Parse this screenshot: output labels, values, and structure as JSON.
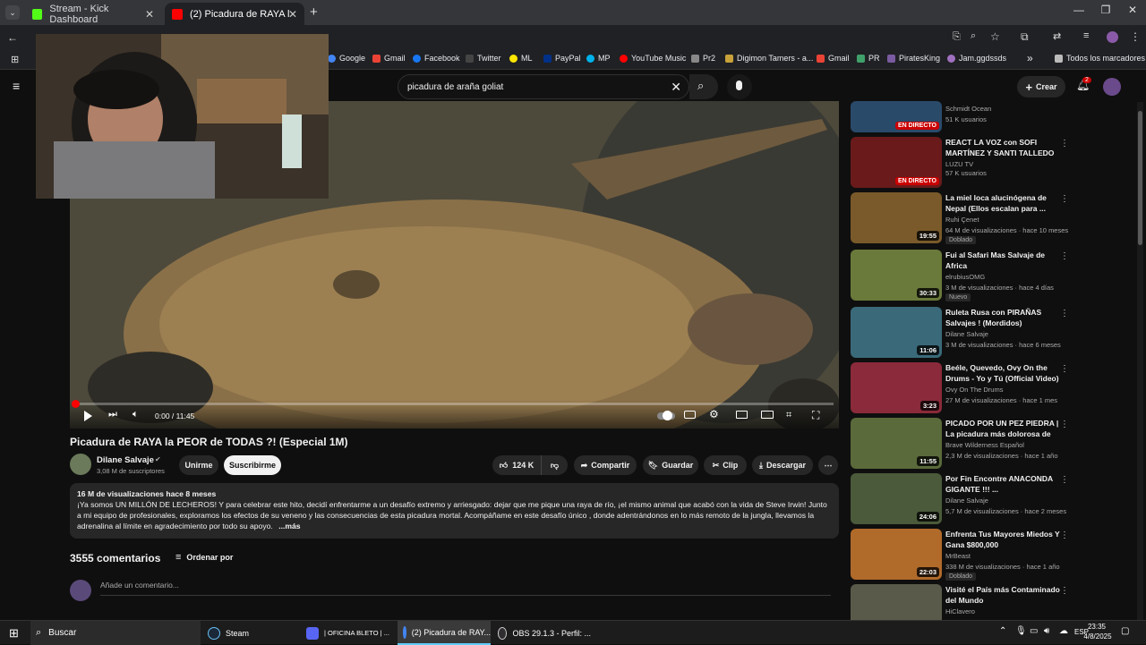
{
  "browser": {
    "tabs": [
      {
        "title": "Stream - Kick Dashboard",
        "color": "#53fc18"
      },
      {
        "title": "(2) Picadura de RAYA la PEOR d",
        "color": "#ff0000"
      }
    ],
    "new_tab": "+",
    "bookmarks": [
      "Google",
      "Gmail",
      "Facebook",
      "Twitter",
      "ML",
      "PayPal",
      "MP",
      "YouTube Music",
      "Pr2",
      "Digimon Tamers - a...",
      "Gmail",
      "PR",
      "PiratesKing",
      "Jam.ggdssds"
    ],
    "all_bookmarks": "Todos los marcadores",
    "more": "»"
  },
  "youtube": {
    "search_value": "picadura de araña goliat",
    "create_label": "Crear",
    "notif_count": "2",
    "player": {
      "time": "0:00 / 11:45",
      "progress": 0.0
    },
    "title": "Picadura de RAYA la PEOR de TODAS ?! (Especial 1M)",
    "channel": {
      "name": "Dilane Salvaje",
      "subs": "3,08 M de suscriptores"
    },
    "join_label": "Unirme",
    "subscribe_label": "Suscribirme",
    "likes": "124 K",
    "share_label": "Compartir",
    "save_label": "Guardar",
    "clip_label": "Clip",
    "download_label": "Descargar",
    "description": {
      "meta": "16 M de visualizaciones  hace 8 meses",
      "text": "¡Ya somos UN MILLÓN DE LECHEROS! Y para celebrar este hito, decidí enfrentarme a un desafío extremo y arriesgado: dejar que me pique una raya de río, ¡el mismo animal que acabó con la vida de Steve Irwin! Junto a mi equipo de profesionales, exploramos los efectos de su veneno y las consecuencias de esta picadura mortal. Acompáñame en este desafío único , donde adentrándonos en lo más remoto de la jungla, llevamos la adrenalina al límite en agradecimiento por todo su apoyo.",
      "more": "...más"
    },
    "comments_count": "3555 comentarios",
    "sort_label": "Ordenar por",
    "add_comment_placeholder": "Añade un comentario...",
    "recommendations": [
      {
        "title": "",
        "channel": "Schmidt Ocean",
        "meta": "51 K usuarios",
        "badge_live": "EN DIRECTO",
        "dur": "",
        "badge": "",
        "thumb": "#2a4a6a"
      },
      {
        "title": "REACT LA VOZ con SOFI MARTÍNEZ Y SANTI TALLEDO ...",
        "channel": "LUZU TV",
        "meta": "57 K usuarios",
        "badge_live": "EN DIRECTO",
        "dur": "",
        "badge": "",
        "thumb": "#6a1a1a"
      },
      {
        "title": "La miel loca alucinógena de Nepal (Ellos escalan para ...",
        "channel": "Ruhi Çenet",
        "meta": "64 M de visualizaciones · hace 10 meses",
        "badge_live": "",
        "dur": "19:55",
        "badge": "Doblado",
        "thumb": "#7a5a2a"
      },
      {
        "title": "Fui al Safari Mas Salvaje de Africa",
        "channel": "elrubiusOMG",
        "meta": "3 M de visualizaciones · hace 4 días",
        "badge_live": "",
        "dur": "30:33",
        "badge": "Nuevo",
        "thumb": "#6a7a3a"
      },
      {
        "title": "Ruleta Rusa con PIRAÑAS Salvajes ! (Mordidos)",
        "channel": "Dilane Salvaje",
        "meta": "3 M de visualizaciones · hace 6 meses",
        "badge_live": "",
        "dur": "11:06",
        "badge": "",
        "thumb": "#3a6a7a"
      },
      {
        "title": "Beéle, Quevedo, Ovy On the Drums - Yo y Tú (Official Video)",
        "channel": "Ovy On The Drums",
        "meta": "27 M de visualizaciones · hace 1 mes",
        "badge_live": "",
        "dur": "3:23",
        "badge": "",
        "thumb": "#8a2a3a"
      },
      {
        "title": "PICADO POR UN PEZ PIEDRA | La picadura más dolorosa de l...",
        "channel": "Brave Wilderness Español",
        "meta": "2,3 M de visualizaciones · hace 1 año",
        "badge_live": "",
        "dur": "11:55",
        "badge": "",
        "thumb": "#5a6a3a"
      },
      {
        "title": "Por Fin Encontre ANACONDA GIGANTE !!! ...",
        "channel": "Dilane Salvaje",
        "meta": "5,7 M de visualizaciones · hace 2 meses",
        "badge_live": "",
        "dur": "24:06",
        "badge": "",
        "thumb": "#4a5a3a"
      },
      {
        "title": "Enfrenta Tus Mayores Miedos Y Gana $800,000",
        "channel": "MrBeast",
        "meta": "338 M de visualizaciones · hace 1 año",
        "badge_live": "",
        "dur": "22:03",
        "badge": "Doblado",
        "thumb": "#b06a2a"
      },
      {
        "title": "Visité el País más Contaminado del Mundo",
        "channel": "HiClavero",
        "meta": "",
        "badge_live": "",
        "dur": "",
        "badge": "",
        "thumb": "#5a5a4a"
      }
    ]
  },
  "taskbar": {
    "search": "Buscar",
    "apps": [
      "Steam",
      "| OFICINA BLETO | ...",
      "(2) Picadura de RAY...",
      "OBS 29.1.3 - Perfil: ..."
    ],
    "lang": "ESP",
    "time": "23:35",
    "date": "4/8/2025"
  }
}
